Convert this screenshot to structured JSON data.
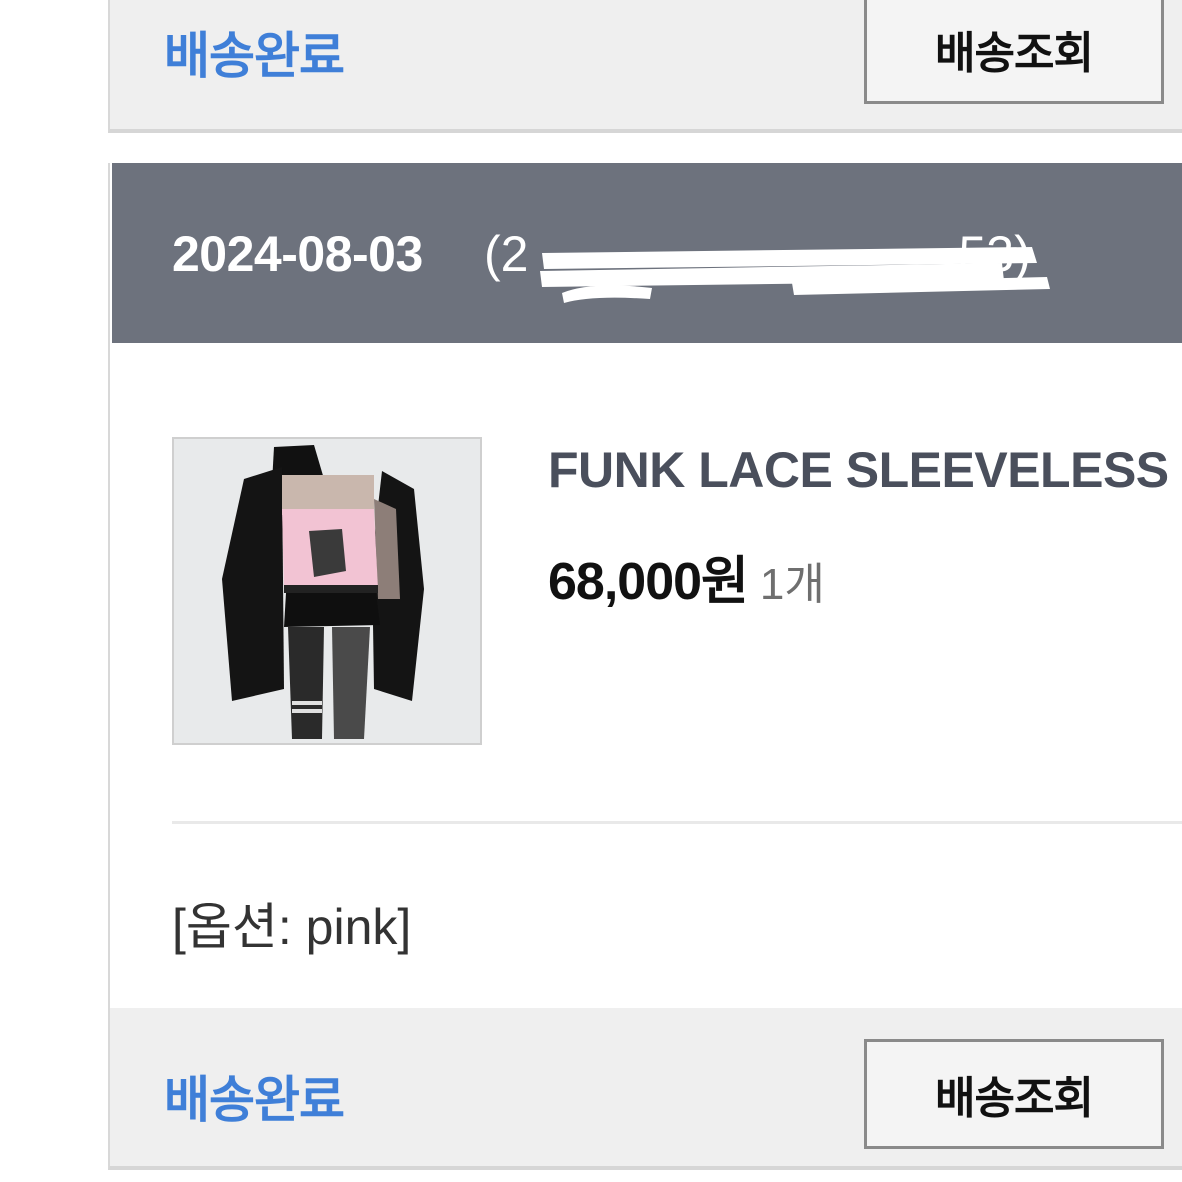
{
  "previous_order": {
    "status_label": "배송완료",
    "track_button_label": "배송조회"
  },
  "order": {
    "date": "2024-08-03",
    "order_number_visible": "(2",
    "order_number_tail": "53)",
    "product": {
      "name": "FUNK LACE SLEEVELESS",
      "price": "68,000원",
      "quantity": "1개",
      "option": "[옵션: pink]"
    },
    "footer": {
      "status_label": "배송완료",
      "track_button_label": "배송조회"
    }
  },
  "colors": {
    "status_blue": "#3f7fd8",
    "header_gray": "#6d727d",
    "panel_gray": "#efefef"
  }
}
